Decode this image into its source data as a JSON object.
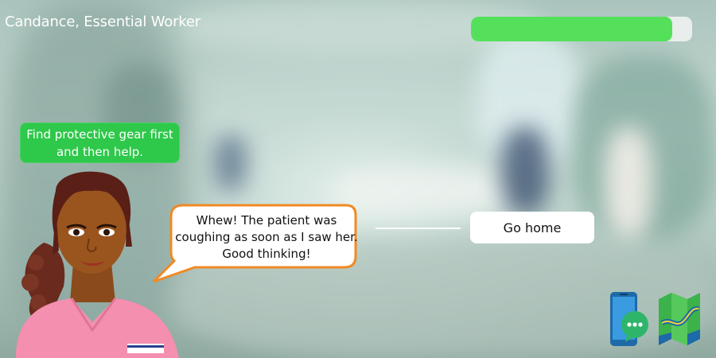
{
  "hud": {
    "character_title": "Candance, Essential Worker",
    "progress": 0.91
  },
  "hint": {
    "text": "Find protective gear first and then help."
  },
  "dialogue": {
    "speech": "Whew! The patient was coughing as soon as I saw her. Good thinking!"
  },
  "choices": [
    {
      "label": "Go home"
    }
  ],
  "icons": {
    "phone": "phone-messages-icon",
    "map": "map-icon"
  },
  "colors": {
    "progress_fill": "#55e05c",
    "hint_bg": "#2ec84a",
    "speech_border": "#f08a24",
    "scrubs": "#f48fb0"
  }
}
